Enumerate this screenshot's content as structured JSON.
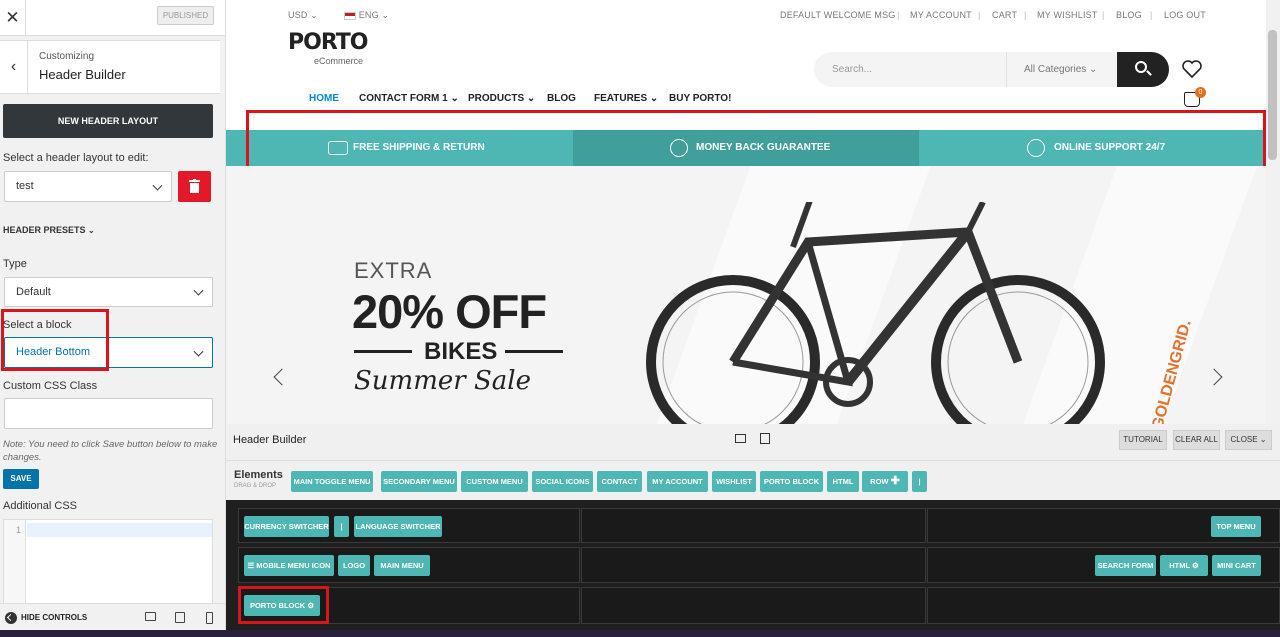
{
  "sidebar": {
    "close_icon": "close-icon",
    "published_label": "PUBLISHED",
    "customizing_label": "Customizing",
    "title": "Header Builder",
    "new_layout_label": "NEW HEADER LAYOUT",
    "select_layout_label": "Select a header layout to edit:",
    "layout_value": "test",
    "presets_label": "HEADER PRESETS",
    "type_label": "Type",
    "type_value": "Default",
    "block_label": "Select a block",
    "block_value": "Header Bottom",
    "css_class_label": "Custom CSS Class",
    "css_class_value": "",
    "note": "Note: You need to click Save button below to make changes.",
    "save_label": "SAVE",
    "additional_css_label": "Additional CSS",
    "css_line_number": "1",
    "hide_controls_label": "HIDE CONTROLS"
  },
  "preview": {
    "topbar": {
      "currency": "USD",
      "language": "ENG",
      "links": [
        "DEFAULT WELCOME MSG",
        "MY ACCOUNT",
        "CART",
        "MY WISHLIST",
        "BLOG",
        "LOG OUT"
      ],
      "separator": "|"
    },
    "logo": {
      "name": "PORTO",
      "sub": "eCommerce"
    },
    "search": {
      "placeholder": "Search...",
      "category": "All Categories"
    },
    "cart_count": "0",
    "nav": [
      "HOME",
      "CONTACT FORM 1",
      "PRODUCTS",
      "BLOG",
      "FEATURES",
      "BUY PORTO!"
    ],
    "promo": [
      "FREE SHIPPING & RETURN",
      "MONEY BACK GUARANTEE",
      "ONLINE SUPPORT 24/7"
    ],
    "hero": {
      "extra": "EXTRA",
      "off": "20% OFF",
      "bikes": "BIKES",
      "sale": "Summer Sale",
      "brand": "GOLDENGRID."
    }
  },
  "builder": {
    "title": "Header Builder",
    "tools": [
      "TUTORIAL",
      "CLEAR ALL",
      "CLOSE"
    ],
    "elements_title": "Elements",
    "elements_sub": "DRAG & DROP",
    "elements": [
      "MAIN TOGGLE MENU",
      "SECONDARY MENU",
      "CUSTOM MENU",
      "SOCIAL ICONS",
      "CONTACT",
      "MY ACCOUNT",
      "WISHLIST",
      "PORTO BLOCK",
      "HTML",
      "ROW",
      "|"
    ],
    "rows": {
      "top_left": [
        "CURRENCY SWITCHER",
        "|",
        "LANGUAGE SWITCHER"
      ],
      "top_right": [
        "TOP MENU"
      ],
      "main_left": [
        "☰ MOBILE MENU ICON",
        "LOGO",
        "MAIN MENU"
      ],
      "main_right": [
        "SEARCH FORM",
        "HTML",
        "MINI CART"
      ],
      "bottom_left": [
        "PORTO BLOCK"
      ]
    }
  },
  "colors": {
    "accent": "#4fb7b3",
    "highlight": "#d9141d",
    "link": "#0088cc",
    "danger": "#e3192a"
  }
}
